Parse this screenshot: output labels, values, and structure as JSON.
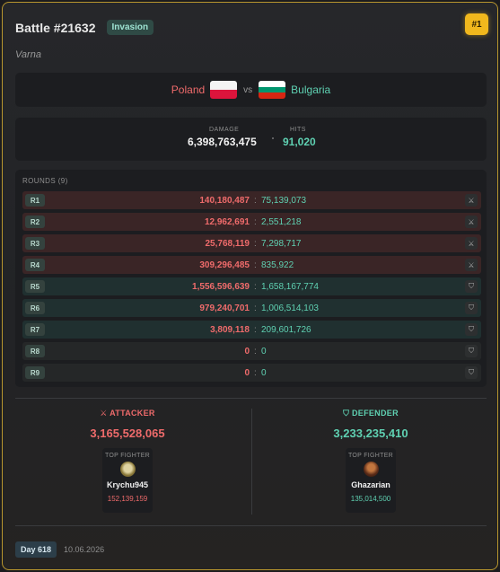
{
  "battle": {
    "title": "Battle #21632",
    "type_badge": "Invasion",
    "rank_badge": "#1",
    "location": "Varna"
  },
  "matchup": {
    "attacker": "Poland",
    "vs": "vs",
    "defender": "Bulgaria"
  },
  "stats": {
    "damage_label": "DAMAGE",
    "damage_value": "6,398,763,475",
    "hits_label": "HITS",
    "hits_value": "91,020"
  },
  "rounds": {
    "title": "ROUNDS (9)",
    "separator": ":",
    "items": [
      {
        "label": "R1",
        "attacker": "140,180,487",
        "defender": "75,139,073",
        "winner": "attacker",
        "icon": "crossed-swords-icon"
      },
      {
        "label": "R2",
        "attacker": "12,962,691",
        "defender": "2,551,218",
        "winner": "attacker",
        "icon": "crossed-swords-icon"
      },
      {
        "label": "R3",
        "attacker": "25,768,119",
        "defender": "7,298,717",
        "winner": "attacker",
        "icon": "crossed-swords-icon"
      },
      {
        "label": "R4",
        "attacker": "309,296,485",
        "defender": "835,922",
        "winner": "attacker",
        "icon": "crossed-swords-icon"
      },
      {
        "label": "R5",
        "attacker": "1,556,596,639",
        "defender": "1,658,167,774",
        "winner": "defender",
        "icon": "shield-icon"
      },
      {
        "label": "R6",
        "attacker": "979,240,701",
        "defender": "1,006,514,103",
        "winner": "defender",
        "icon": "shield-icon"
      },
      {
        "label": "R7",
        "attacker": "3,809,118",
        "defender": "209,601,726",
        "winner": "defender",
        "icon": "shield-icon"
      },
      {
        "label": "R8",
        "attacker": "0",
        "defender": "0",
        "winner": "none",
        "icon": "shield-icon"
      },
      {
        "label": "R9",
        "attacker": "0",
        "defender": "0",
        "winner": "none",
        "icon": "shield-icon"
      }
    ]
  },
  "attacker_side": {
    "heading": "ATTACKER",
    "icon": "crossed-swords-icon",
    "total": "3,165,528,065",
    "top_fighter_label": "TOP FIGHTER",
    "top_fighter_name": "Krychu945",
    "top_fighter_damage": "152,139,159"
  },
  "defender_side": {
    "heading": "DEFENDER",
    "icon": "shield-icon",
    "total": "3,233,235,410",
    "top_fighter_label": "TOP FIGHTER",
    "top_fighter_name": "Ghazarian",
    "top_fighter_damage": "135,014,500"
  },
  "footer": {
    "day": "Day 618",
    "date": "10.06.2026"
  },
  "colors": {
    "accent_gold": "#f1b81d",
    "attacker_red": "#ef6b6b",
    "defender_teal": "#5fd1b2",
    "border_gold": "#b8962e"
  }
}
